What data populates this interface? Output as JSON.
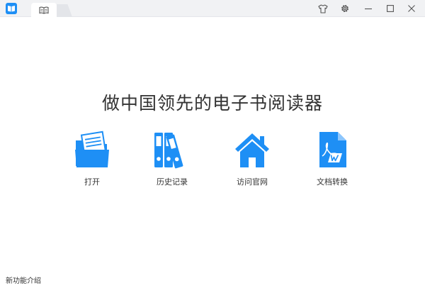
{
  "colors": {
    "accent": "#1e8ff5",
    "accent_light": "#61b0fb",
    "titlebar_bg": "#f1f2f4",
    "text": "#333333"
  },
  "titlebar": {
    "app_icon": "book-logo-icon",
    "tab_icon": "open-book-icon",
    "buttons": {
      "skin": "tshirt-icon",
      "settings": "gear-icon",
      "minimize": "minimize-icon",
      "maximize": "maximize-icon",
      "close": "close-icon"
    }
  },
  "main": {
    "headline": "做中国领先的电子书阅读器",
    "actions": [
      {
        "label": "打开",
        "icon": "folder-open-icon"
      },
      {
        "label": "历史记录",
        "icon": "binders-history-icon"
      },
      {
        "label": "访问官网",
        "icon": "home-icon"
      },
      {
        "label": "文档转换",
        "icon": "pdf-to-word-icon"
      }
    ]
  },
  "footer": {
    "link": "新功能介绍"
  }
}
